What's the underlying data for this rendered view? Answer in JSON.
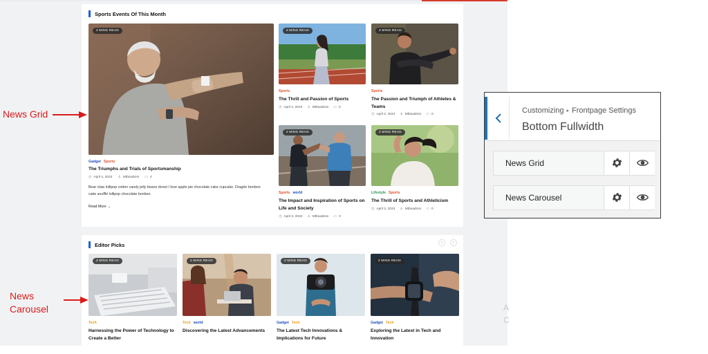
{
  "site": {
    "news_grid": {
      "section_title": "Sports Events Of This Month",
      "featured": {
        "badge": "2 MINS READ",
        "categories": [
          {
            "label": "Gadget",
            "color": "#1a4fbf"
          },
          {
            "label": "Sports",
            "color": "#e0502a"
          }
        ],
        "title": "The Triumphs and Trials of Sportsmanship",
        "date": "April 4, 2023",
        "author": "Mtbsadmin",
        "comments": "0",
        "excerpt": "Bear claw lollipop cotton candy jelly beans donut I love apple pie chocolate cake cupcake. Dragée bonbon cake soufflé lollipop chocolate bonbon.",
        "read_more": "Read More →"
      },
      "items": [
        {
          "badge": "2 MINS READ",
          "categories": [
            {
              "label": "Sports",
              "color": "#e0502a"
            }
          ],
          "title": "The Thrill and Passion of Sports",
          "date": "April 4, 2023",
          "author": "Mtbsadmin",
          "comments": "0"
        },
        {
          "badge": "2 MINS READ",
          "categories": [
            {
              "label": "Sports",
              "color": "#e0502a"
            }
          ],
          "title": "The Passion and Triumph of Athletes & Teams",
          "date": "April 3, 2023",
          "author": "Mtbsadmin",
          "comments": "0"
        },
        {
          "badge": "2 MINS READ",
          "categories": [
            {
              "label": "Sports",
              "color": "#e0502a"
            },
            {
              "label": "world",
              "color": "#1a4fbf"
            }
          ],
          "title": "The Impact and Inspiration of Sports on Life and Society",
          "date": "April 3, 2023",
          "author": "Mtbsadmin",
          "comments": "0"
        },
        {
          "badge": "2 MINS READ",
          "categories": [
            {
              "label": "Lifestyle",
              "color": "#2a9a55"
            },
            {
              "label": "Sports",
              "color": "#e0502a"
            }
          ],
          "title": "The Thrill of Sports and Athleticism",
          "date": "April 3, 2023",
          "author": "Mtbsadmin",
          "comments": "0"
        }
      ]
    },
    "editor_picks": {
      "section_title": "Editor Picks",
      "prev_arrow": "‹",
      "next_arrow": "›",
      "items": [
        {
          "badge": "2 MINS READ",
          "categories": [
            {
              "label": "Tech",
              "color": "#e89b16"
            }
          ],
          "title": "Harnessing the Power of Technology to Create a Better"
        },
        {
          "badge": "2 MINS READ",
          "categories": [
            {
              "label": "Tech",
              "color": "#e89b16"
            },
            {
              "label": "world",
              "color": "#1a4fbf"
            }
          ],
          "title": "Discovering the Latest Advancements"
        },
        {
          "badge": "2 MINS READ",
          "categories": [
            {
              "label": "Gadget",
              "color": "#1a4fbf"
            },
            {
              "label": "Tech",
              "color": "#e89b16"
            }
          ],
          "title": "The Latest Tech Innovations & Implications for Future"
        },
        {
          "badge": "2 MINS READ",
          "categories": [
            {
              "label": "Gadget",
              "color": "#1a4fbf"
            },
            {
              "label": "Tech",
              "color": "#e89b16"
            }
          ],
          "title": "Exploring the Latest in Tech and Innovation"
        }
      ]
    }
  },
  "annotations": {
    "news_grid": "News Grid",
    "news_carousel_line1": "News",
    "news_carousel_line2": "Carousel",
    "arrow_color": "#d91b1b"
  },
  "faded_text": {
    "a": "A",
    "c": "C"
  },
  "customizer": {
    "back_icon": "chevron-left-icon",
    "breadcrumb_root": "Customizing",
    "breadcrumb_separator": "▸",
    "breadcrumb_section": "Frontpage Settings",
    "title": "Bottom Fullwidth",
    "rows": [
      {
        "label": "News Grid",
        "settings_icon": "gear-icon",
        "visibility_icon": "eye-icon"
      },
      {
        "label": "News Carousel",
        "settings_icon": "gear-icon",
        "visibility_icon": "eye-icon"
      }
    ],
    "accent_color": "#2271b1"
  }
}
